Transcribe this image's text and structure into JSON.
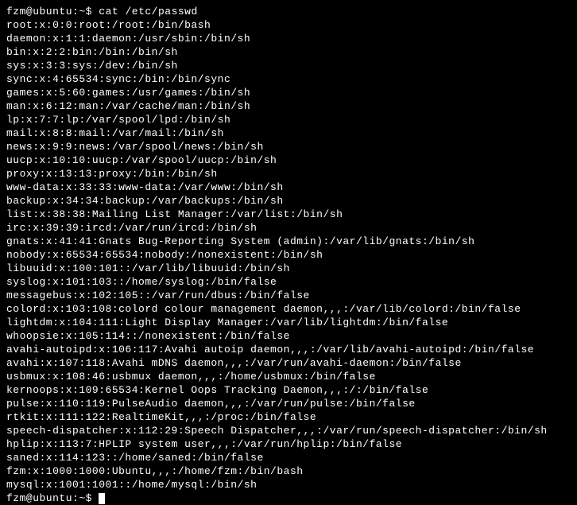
{
  "prompt_start": {
    "user_host": "fzm@ubuntu",
    "separator": ":",
    "path": "~",
    "symbol": "$",
    "command": "cat /etc/passwd"
  },
  "output_lines": [
    "root:x:0:0:root:/root:/bin/bash",
    "daemon:x:1:1:daemon:/usr/sbin:/bin/sh",
    "bin:x:2:2:bin:/bin:/bin/sh",
    "sys:x:3:3:sys:/dev:/bin/sh",
    "sync:x:4:65534:sync:/bin:/bin/sync",
    "games:x:5:60:games:/usr/games:/bin/sh",
    "man:x:6:12:man:/var/cache/man:/bin/sh",
    "lp:x:7:7:lp:/var/spool/lpd:/bin/sh",
    "mail:x:8:8:mail:/var/mail:/bin/sh",
    "news:x:9:9:news:/var/spool/news:/bin/sh",
    "uucp:x:10:10:uucp:/var/spool/uucp:/bin/sh",
    "proxy:x:13:13:proxy:/bin:/bin/sh",
    "www-data:x:33:33:www-data:/var/www:/bin/sh",
    "backup:x:34:34:backup:/var/backups:/bin/sh",
    "list:x:38:38:Mailing List Manager:/var/list:/bin/sh",
    "irc:x:39:39:ircd:/var/run/ircd:/bin/sh",
    "gnats:x:41:41:Gnats Bug-Reporting System (admin):/var/lib/gnats:/bin/sh",
    "nobody:x:65534:65534:nobody:/nonexistent:/bin/sh",
    "libuuid:x:100:101::/var/lib/libuuid:/bin/sh",
    "syslog:x:101:103::/home/syslog:/bin/false",
    "messagebus:x:102:105::/var/run/dbus:/bin/false",
    "colord:x:103:108:colord colour management daemon,,,:/var/lib/colord:/bin/false",
    "lightdm:x:104:111:Light Display Manager:/var/lib/lightdm:/bin/false",
    "whoopsie:x:105:114::/nonexistent:/bin/false",
    "avahi-autoipd:x:106:117:Avahi autoip daemon,,,:/var/lib/avahi-autoipd:/bin/false",
    "avahi:x:107:118:Avahi mDNS daemon,,,:/var/run/avahi-daemon:/bin/false",
    "usbmux:x:108:46:usbmux daemon,,,:/home/usbmux:/bin/false",
    "kernoops:x:109:65534:Kernel Oops Tracking Daemon,,,:/:/bin/false",
    "pulse:x:110:119:PulseAudio daemon,,,:/var/run/pulse:/bin/false",
    "rtkit:x:111:122:RealtimeKit,,,:/proc:/bin/false",
    "speech-dispatcher:x:112:29:Speech Dispatcher,,,:/var/run/speech-dispatcher:/bin/sh",
    "hplip:x:113:7:HPLIP system user,,,:/var/run/hplip:/bin/false",
    "saned:x:114:123::/home/saned:/bin/false",
    "fzm:x:1000:1000:Ubuntu,,,:/home/fzm:/bin/bash",
    "mysql:x:1001:1001::/home/mysql:/bin/sh"
  ],
  "prompt_end": {
    "user_host": "fzm@ubuntu",
    "separator": ":",
    "path": "~",
    "symbol": "$"
  }
}
